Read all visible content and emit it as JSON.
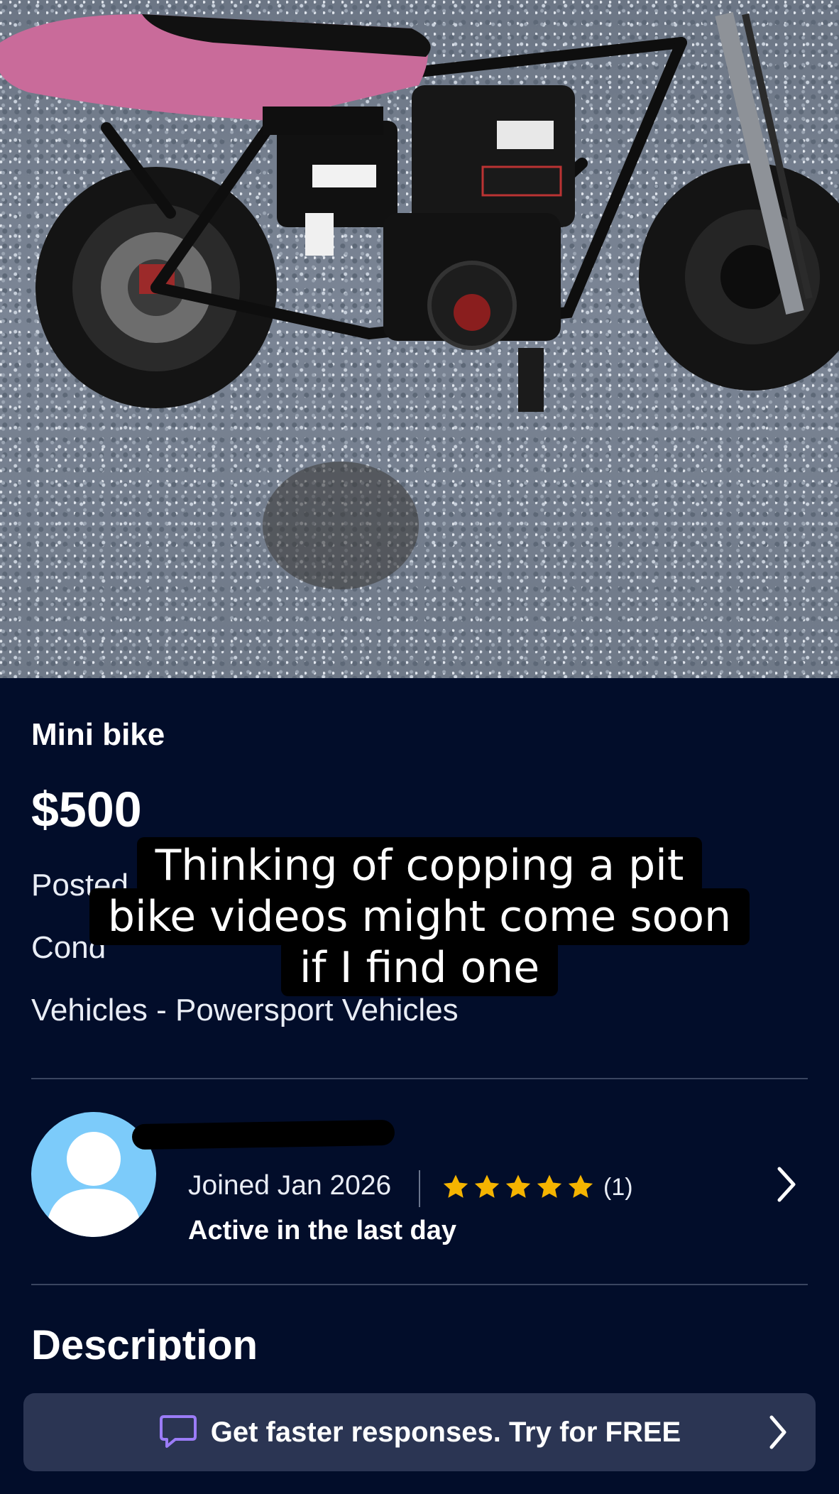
{
  "listing": {
    "title": "Mini bike",
    "price": "$500",
    "posted_label": "Posted",
    "condition_label": "Cond",
    "category": "Vehicles - Powersport Vehicles",
    "photo_alt": "mini-bike-photo"
  },
  "caption_overlay": {
    "lines": [
      "Thinking of copping a pit",
      "bike videos might come soon",
      "if I find one"
    ]
  },
  "seller": {
    "joined": "Joined Jan 2026",
    "rating_stars": 5,
    "rating_count": "(1)",
    "activity": "Active in the last day"
  },
  "description": {
    "heading": "Description"
  },
  "cta": {
    "label": "Get faster responses. Try for FREE"
  },
  "colors": {
    "background": "#020d2a",
    "star": "#f5b400",
    "avatar": "#7ccbfa",
    "cta_bg": "#2b3553",
    "chat_icon": "#9b7cf7"
  }
}
